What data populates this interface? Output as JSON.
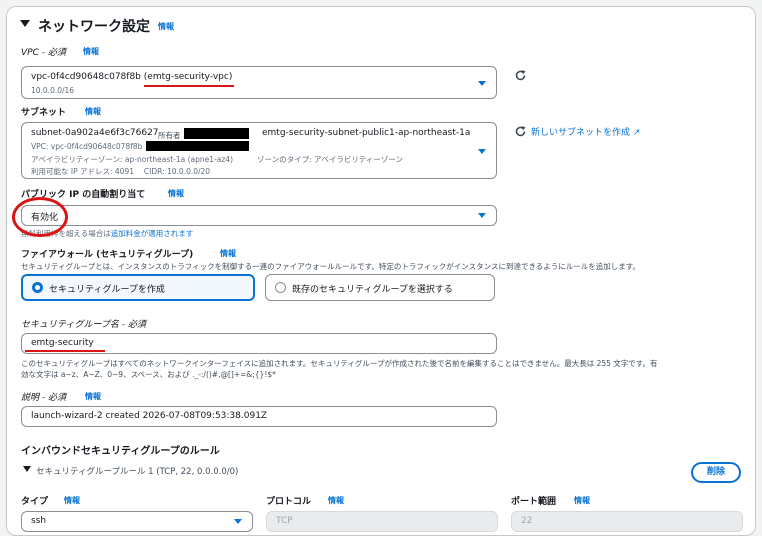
{
  "network": {
    "title": "ネットワーク設定",
    "info": "情報"
  },
  "vpc": {
    "label": "VPC - 必須",
    "info": "情報",
    "id": "vpc-0f4cd90648c078f8b",
    "name": "(emtg-security-vpc)",
    "cidr": "10.0.0.0/16"
  },
  "subnet": {
    "label": "サブネット",
    "info": "情報",
    "id": "subnet-0a902a4e6f3c76627",
    "owner_label": "所有者",
    "name": "emtg-security-subnet-public1-ap-northeast-1a",
    "line2_vpc": "VPC: vpc-0f4cd90648c078f8b",
    "line3_az": "アベイラビリティーゾーン: ap-northeast-1a (apne1-az4)",
    "line3_zone_type": "ゾーンのタイプ: アベイラビリティーゾーン",
    "line4": "利用可能な IP アドレス: 4091　 CIDR: 10.0.0.0/20",
    "create_link": "新しいサブネットを作成"
  },
  "public_ip": {
    "label": "パブリック IP の自動割り当て",
    "info": "情報",
    "value": "有効化",
    "note_prefix": "無料利用枠を超える場合は",
    "note_link": "追加料金が適用されます"
  },
  "firewall": {
    "label": "ファイアウォール (セキュリティグループ)",
    "info": "情報",
    "description": "セキュリティグループとは、インスタンスのトラフィックを制御する一連のファイアウォールルールです。特定のトラフィックがインスタンスに到達できるようにルールを追加します。",
    "option_create": "セキュリティグループを作成",
    "option_existing": "既存のセキュリティグループを選択する"
  },
  "sg_name": {
    "label": "セキュリティグループ名 - 必須",
    "value": "emtg-security",
    "help1": "このセキュリティグループはすべてのネットワークインターフェイスに追加されます。セキュリティグループが作成された後で名前を編集することはできません。最大長は 255 文字です。有",
    "help2": "効な文字は a~z、A~Z、0~9、スペース、および ._-:/()#,@[]+=&;{}!$*"
  },
  "description_field": {
    "label": "説明 - 必須",
    "info": "情報",
    "value": "launch-wizard-2 created 2026-07-08T09:53:38.091Z"
  },
  "inbound": {
    "title": "インバウンドセキュリティグループのルール",
    "rule_title": "セキュリティグループルール 1 (TCP, 22, 0.0.0.0/0)",
    "delete": "削除",
    "type_label": "タイプ",
    "protocol_label": "プロトコル",
    "port_label": "ポート範囲",
    "info": "情報",
    "type_value": "ssh",
    "protocol_value": "TCP",
    "port_value": "22"
  },
  "colors": {
    "accent": "#0972d3",
    "annotation": "#d91515"
  }
}
